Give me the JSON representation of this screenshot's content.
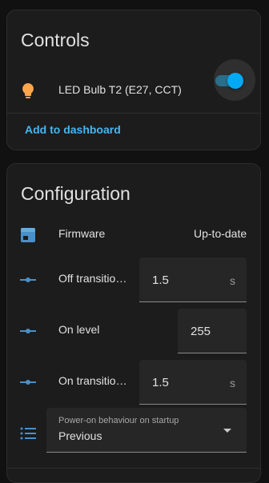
{
  "controls": {
    "title": "Controls",
    "entity": {
      "icon": "lightbulb-icon",
      "label": "LED Bulb T2 (E27, CCT)",
      "state": "on"
    },
    "add_to_dashboard": "Add to dashboard"
  },
  "configuration": {
    "title": "Configuration",
    "firmware": {
      "icon": "package-icon",
      "label": "Firmware",
      "value": "Up-to-date"
    },
    "off_transition": {
      "icon": "slider-icon",
      "label": "Off transitio…",
      "value": "1.5",
      "unit": "s"
    },
    "on_level": {
      "icon": "slider-icon",
      "label": "On level",
      "value": "255"
    },
    "on_transition": {
      "icon": "slider-icon",
      "label": "On transitio…",
      "value": "1.5",
      "unit": "s"
    },
    "power_on": {
      "icon": "list-icon",
      "label": "Power-on behaviour on startup",
      "value": "Previous"
    }
  },
  "colors": {
    "accent": "#03a9f4",
    "link": "#42b7f4",
    "bulb": "#ffa64d",
    "icon": "#4a90c8"
  }
}
